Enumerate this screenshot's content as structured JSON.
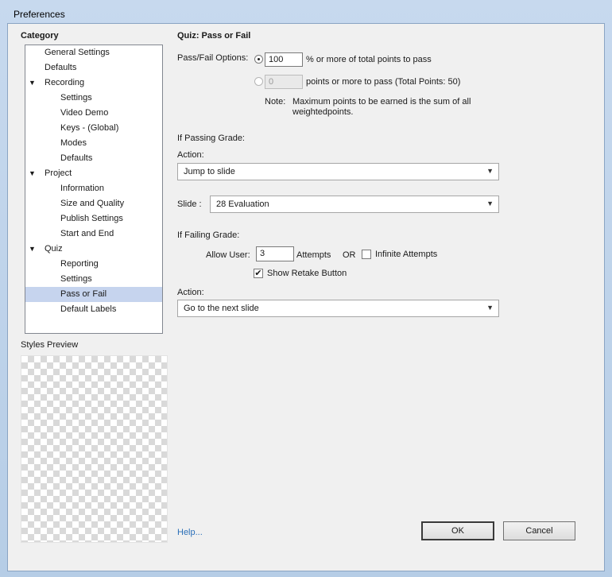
{
  "window": {
    "title": "Preferences"
  },
  "category": {
    "heading": "Category",
    "items": [
      {
        "label": "General Settings",
        "level": 0,
        "arrow": "",
        "selected": false
      },
      {
        "label": "Defaults",
        "level": 0,
        "arrow": "",
        "selected": false
      },
      {
        "label": "Recording",
        "level": 0,
        "arrow": "▼",
        "selected": false
      },
      {
        "label": "Settings",
        "level": 1,
        "arrow": "",
        "selected": false
      },
      {
        "label": "Video Demo",
        "level": 1,
        "arrow": "",
        "selected": false
      },
      {
        "label": "Keys - (Global)",
        "level": 1,
        "arrow": "",
        "selected": false
      },
      {
        "label": "Modes",
        "level": 1,
        "arrow": "",
        "selected": false
      },
      {
        "label": "Defaults",
        "level": 1,
        "arrow": "",
        "selected": false
      },
      {
        "label": "Project",
        "level": 0,
        "arrow": "▼",
        "selected": false
      },
      {
        "label": "Information",
        "level": 1,
        "arrow": "",
        "selected": false
      },
      {
        "label": "Size and Quality",
        "level": 1,
        "arrow": "",
        "selected": false
      },
      {
        "label": "Publish Settings",
        "level": 1,
        "arrow": "",
        "selected": false
      },
      {
        "label": "Start and End",
        "level": 1,
        "arrow": "",
        "selected": false
      },
      {
        "label": "Quiz",
        "level": 0,
        "arrow": "▼",
        "selected": false
      },
      {
        "label": "Reporting",
        "level": 1,
        "arrow": "",
        "selected": false
      },
      {
        "label": "Settings",
        "level": 1,
        "arrow": "",
        "selected": false
      },
      {
        "label": "Pass or Fail",
        "level": 1,
        "arrow": "",
        "selected": true
      },
      {
        "label": "Default Labels",
        "level": 1,
        "arrow": "",
        "selected": false
      }
    ]
  },
  "styles_preview": {
    "label": "Styles Preview"
  },
  "panel": {
    "title": "Quiz: Pass or Fail",
    "options_label": "Pass/Fail Options:",
    "percent_value": "100",
    "percent_text": "% or more of total points to pass",
    "points_value": "0",
    "points_text": "points or more to pass (Total Points: 50)",
    "note_label": "Note:",
    "note_line1": "Maximum points to be earned is the sum of all",
    "note_line2": "weightedpoints.",
    "passing_heading": "If Passing Grade:",
    "pass_action_label": "Action:",
    "pass_action_value": "Jump to slide",
    "slide_label": "Slide :",
    "slide_value": "28 Evaluation",
    "failing_heading": "If Failing Grade:",
    "allow_user_label": "Allow User:",
    "attempts_value": "3",
    "attempts_text": "Attempts",
    "or_text": "OR",
    "infinite_label": "Infinite Attempts",
    "infinite_checked": false,
    "retake_label": "Show Retake Button",
    "retake_checked": true,
    "fail_action_label": "Action:",
    "fail_action_value": "Go to the next slide"
  },
  "footer": {
    "help": "Help...",
    "ok": "OK",
    "cancel": "Cancel"
  },
  "glyphs": {
    "caret": "▼",
    "check": "✔"
  }
}
